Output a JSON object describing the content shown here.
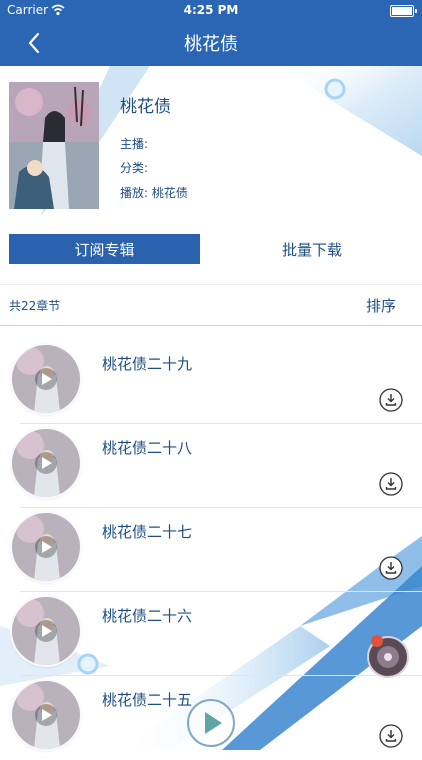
{
  "status_bar": {
    "carrier": "Carrier",
    "time": "4:25 PM"
  },
  "nav": {
    "title": "桃花债"
  },
  "album": {
    "title": "桃花债",
    "host_label": "主播:",
    "category_label": "分类:",
    "play_label": "播放:",
    "play_value": "桃花债"
  },
  "actions": {
    "subscribe_label": "订阅专辑",
    "batch_download_label": "批量下载"
  },
  "list_header": {
    "count_label": "共22章节",
    "sort_label": "排序"
  },
  "episodes": [
    {
      "title": "桃花债二十九"
    },
    {
      "title": "桃花债二十八"
    },
    {
      "title": "桃花债二十七"
    },
    {
      "title": "桃花债二十六"
    },
    {
      "title": "桃花债二十五"
    }
  ],
  "colors": {
    "nav_bg": "#2a66b3",
    "accent": "#2a62ae",
    "text": "#1f4e84"
  }
}
